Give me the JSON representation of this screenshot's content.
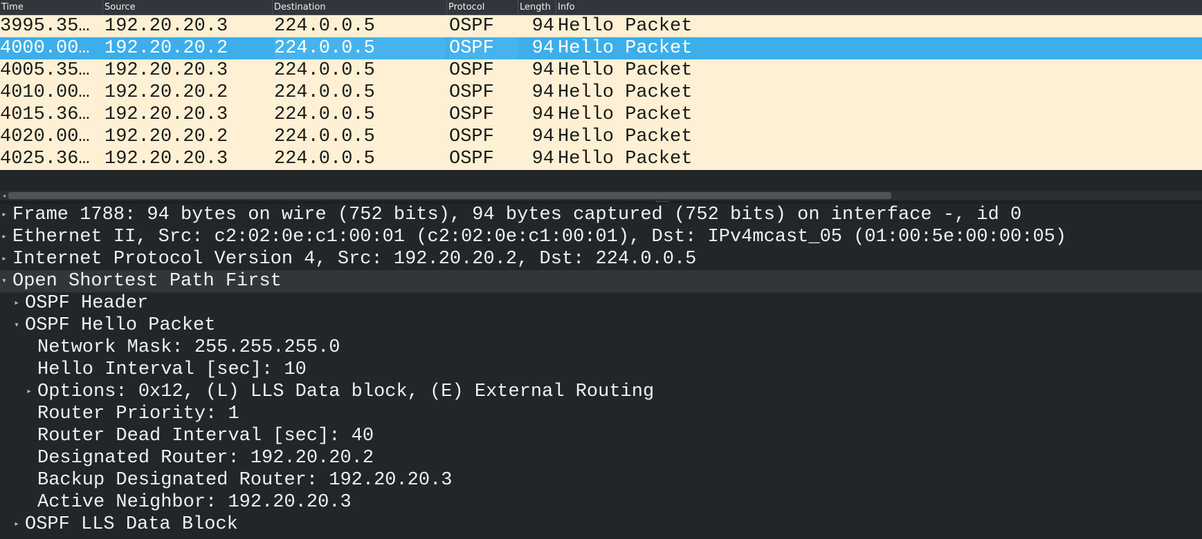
{
  "columns": {
    "time": "Time",
    "source": "Source",
    "destination": "Destination",
    "protocol": "Protocol",
    "length": "Length",
    "info": "Info"
  },
  "packets": [
    {
      "time": "3995.35…",
      "source": "192.20.20.3",
      "destination": "224.0.0.5",
      "protocol": "OSPF",
      "length": "94",
      "info": "Hello Packet"
    },
    {
      "time": "4000.00…",
      "source": "192.20.20.2",
      "destination": "224.0.0.5",
      "protocol": "OSPF",
      "length": "94",
      "info": "Hello Packet"
    },
    {
      "time": "4005.35…",
      "source": "192.20.20.3",
      "destination": "224.0.0.5",
      "protocol": "OSPF",
      "length": "94",
      "info": "Hello Packet"
    },
    {
      "time": "4010.00…",
      "source": "192.20.20.2",
      "destination": "224.0.0.5",
      "protocol": "OSPF",
      "length": "94",
      "info": "Hello Packet"
    },
    {
      "time": "4015.36…",
      "source": "192.20.20.3",
      "destination": "224.0.0.5",
      "protocol": "OSPF",
      "length": "94",
      "info": "Hello Packet"
    },
    {
      "time": "4020.00…",
      "source": "192.20.20.2",
      "destination": "224.0.0.5",
      "protocol": "OSPF",
      "length": "94",
      "info": "Hello Packet"
    },
    {
      "time": "4025.36…",
      "source": "192.20.20.3",
      "destination": "224.0.0.5",
      "protocol": "OSPF",
      "length": "94",
      "info": "Hello Packet"
    }
  ],
  "selected_packet_index": 1,
  "details": [
    {
      "text": "Frame 1788: 94 bytes on wire (752 bits), 94 bytes captured (752 bits) on interface -, id 0",
      "level": 0,
      "expander": "collapsed"
    },
    {
      "text": "Ethernet II, Src: c2:02:0e:c1:00:01 (c2:02:0e:c1:00:01), Dst: IPv4mcast_05 (01:00:5e:00:00:05)",
      "level": 0,
      "expander": "collapsed"
    },
    {
      "text": "Internet Protocol Version 4, Src: 192.20.20.2, Dst: 224.0.0.5",
      "level": 0,
      "expander": "collapsed"
    },
    {
      "text": "Open Shortest Path First",
      "level": 0,
      "expander": "expanded",
      "selected": true
    },
    {
      "text": "OSPF Header",
      "level": 1,
      "expander": "collapsed"
    },
    {
      "text": "OSPF Hello Packet",
      "level": 1,
      "expander": "expanded"
    },
    {
      "text": "Network Mask: 255.255.255.0",
      "level": 2,
      "expander": "none"
    },
    {
      "text": "Hello Interval [sec]: 10",
      "level": 2,
      "expander": "none"
    },
    {
      "text": "Options: 0x12, (L) LLS Data block, (E) External Routing",
      "level": 2,
      "expander": "collapsed"
    },
    {
      "text": "Router Priority: 1",
      "level": 2,
      "expander": "none"
    },
    {
      "text": "Router Dead Interval [sec]: 40",
      "level": 2,
      "expander": "none"
    },
    {
      "text": "Designated Router: 192.20.20.2",
      "level": 2,
      "expander": "none"
    },
    {
      "text": "Backup Designated Router: 192.20.20.3",
      "level": 2,
      "expander": "none"
    },
    {
      "text": "Active Neighbor: 192.20.20.3",
      "level": 2,
      "expander": "none"
    },
    {
      "text": "OSPF LLS Data Block",
      "level": 1,
      "expander": "collapsed"
    }
  ],
  "icons": {
    "collapsed": "▸",
    "expanded": "▾",
    "scroll_left": "◂"
  },
  "colors": {
    "row_bg": "#fdf0d4",
    "selected_row_bg": "#3daee9",
    "panel_bg": "#232629"
  }
}
